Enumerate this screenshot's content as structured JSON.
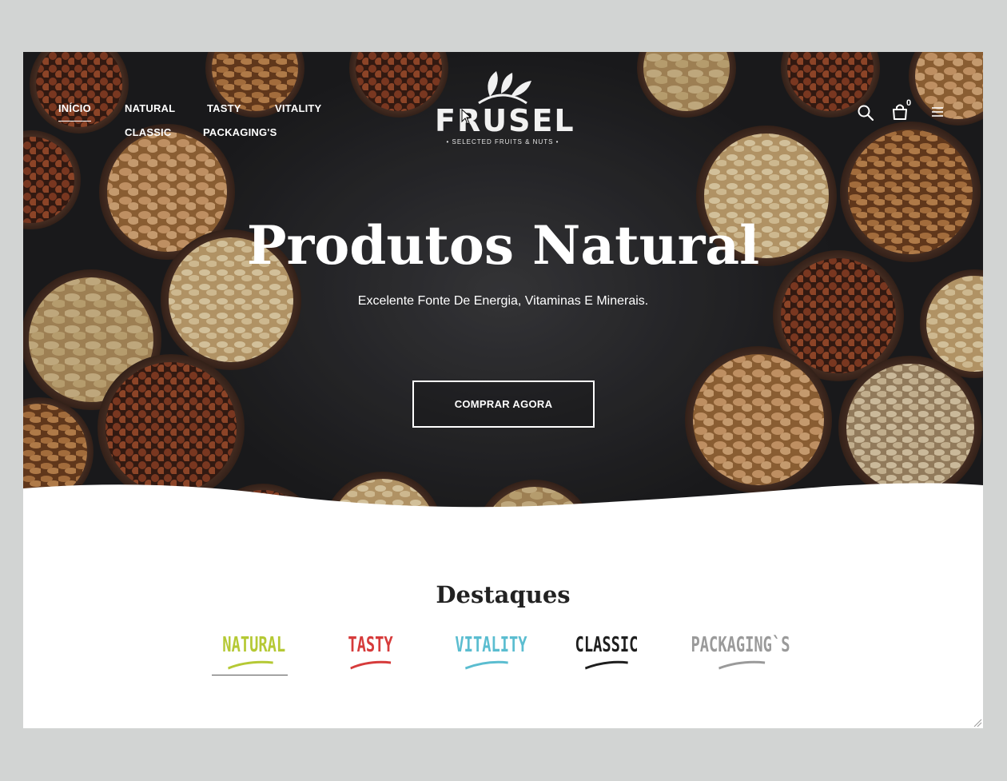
{
  "nav": {
    "items": [
      {
        "label": "INÍCIO",
        "active": true
      },
      {
        "label": "NATURAL"
      },
      {
        "label": "TASTY"
      },
      {
        "label": "VITALITY"
      },
      {
        "label": "CLASSIC"
      },
      {
        "label": "PACKAGING'S"
      }
    ]
  },
  "logo": {
    "brand": "FRUSEL",
    "tagline": "• SELECTED FRUITS & NUTS •"
  },
  "header_icons": {
    "search": "search-icon",
    "cart": "cart-icon",
    "cart_count": "0",
    "menu": "menu-icon"
  },
  "hero": {
    "title": "Produtos Natural",
    "subtitle": "Excelente Fonte De Energia, Vitaminas E Minerais.",
    "cta_label": "COMPRAR AGORA"
  },
  "highlights": {
    "title": "Destaques",
    "tabs": [
      {
        "label": "NATURAL",
        "color": "#b5c935"
      },
      {
        "label": "TASTY",
        "color": "#d63b3b"
      },
      {
        "label": "VITALITY",
        "color": "#5bbdd0"
      },
      {
        "label": "CLASSIC",
        "color": "#1e1e1e"
      },
      {
        "label": "PACKAGING`S",
        "color": "#9a9a9a"
      }
    ]
  },
  "colors": {
    "page_bg": "#d2d4d3",
    "hero_bg": "#2d2d30",
    "bowl": "#6b4a3a"
  }
}
